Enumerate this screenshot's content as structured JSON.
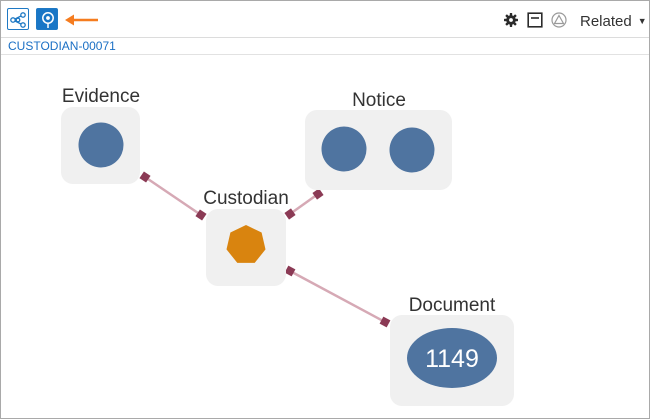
{
  "toolbar": {
    "buttons": [
      {
        "icon": "network-graph-icon",
        "state": "outlined"
      },
      {
        "icon": "location-pin-icon",
        "state": "selected"
      }
    ],
    "pointer_arrow_color": "#f57c1f",
    "right_icons": [
      "gear-icon",
      "layout-panel-icon",
      "shape-warning-icon"
    ],
    "related_label": "Related",
    "related_caret": "▼"
  },
  "breadcrumb": {
    "text": "CUSTODIAN-00071"
  },
  "graph": {
    "colors": {
      "node_circle": "#4f74a0",
      "center_node": "#d9840f",
      "tile_bg": "#f0f0f0",
      "edge": "#d6a9b5",
      "edge_end": "#8b3a55"
    },
    "nodes": {
      "evidence": {
        "label": "Evidence",
        "shape": "circle",
        "count": 1
      },
      "notice": {
        "label": "Notice",
        "shape": "circle",
        "count": 2
      },
      "custodian": {
        "label": "Custodian",
        "shape": "heptagon",
        "count": 1
      },
      "document": {
        "label": "Document",
        "shape": "ellipse",
        "value": "1149"
      }
    },
    "edges": [
      {
        "from": "custodian",
        "to": "evidence"
      },
      {
        "from": "custodian",
        "to": "notice"
      },
      {
        "from": "custodian",
        "to": "document"
      }
    ]
  }
}
